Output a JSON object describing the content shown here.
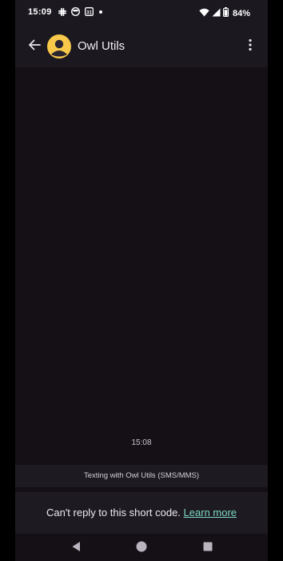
{
  "status_bar": {
    "time": "15:09",
    "battery_percent": "84%",
    "icons_left": [
      "slack-icon",
      "face-icon",
      "calendar-icon",
      "dot-icon"
    ],
    "calendar_day": "31",
    "icons_right": [
      "wifi-icon",
      "signal-icon",
      "battery-icon"
    ]
  },
  "app_bar": {
    "title": "Owl Utils",
    "back_icon": "arrow-back-icon",
    "avatar_icon": "person-avatar-icon",
    "menu_icon": "more-vert-icon",
    "avatar_color": "#f7c84a"
  },
  "conversation": {
    "timestamp": "15:08",
    "texting_with": "Texting with Owl Utils (SMS/MMS)",
    "cant_reply_text": "Can't reply to this short code.",
    "learn_more": "Learn more",
    "link_color": "#7fd8c6"
  },
  "nav_bar": {
    "back": "nav-back-icon",
    "home": "nav-home-icon",
    "recents": "nav-recents-icon"
  }
}
